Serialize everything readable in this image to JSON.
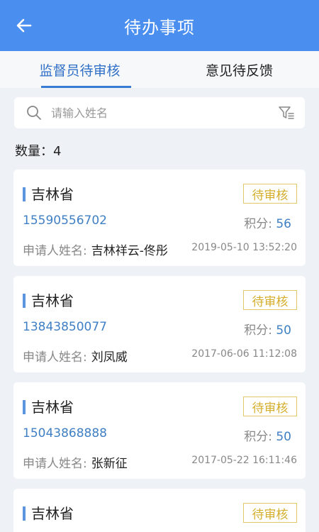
{
  "header": {
    "title": "待办事项"
  },
  "tabs": [
    {
      "label": "监督员待审核",
      "active": true
    },
    {
      "label": "意见待反馈",
      "active": false
    }
  ],
  "search": {
    "placeholder": "请输入姓名"
  },
  "count": {
    "label": "数量：4"
  },
  "items": [
    {
      "province": "吉林省",
      "status": "待审核",
      "phone": "15590556702",
      "score_label": "积分: ",
      "score": "56",
      "applicant_label": "申请人姓名:",
      "applicant": "吉林祥云-佟彤",
      "date": "2019-05-10 13:52:20"
    },
    {
      "province": "吉林省",
      "status": "待审核",
      "phone": "13843850077",
      "score_label": "积分: ",
      "score": "50",
      "applicant_label": "申请人姓名:",
      "applicant": "刘凤威",
      "date": "2017-06-06 11:12:08"
    },
    {
      "province": "吉林省",
      "status": "待审核",
      "phone": "15043868888",
      "score_label": "积分: ",
      "score": "50",
      "applicant_label": "申请人姓名:",
      "applicant": "张新征",
      "date": "2017-05-22 16:11:46"
    },
    {
      "province": "吉林省",
      "status": "待审核"
    }
  ],
  "colors": {
    "header": "#4a8ff0",
    "accent": "#3f7fc4",
    "badge": "#d4ae2c"
  },
  "icons": {
    "back": "arrow-left-icon",
    "search": "search-icon",
    "filter": "filter-icon"
  }
}
